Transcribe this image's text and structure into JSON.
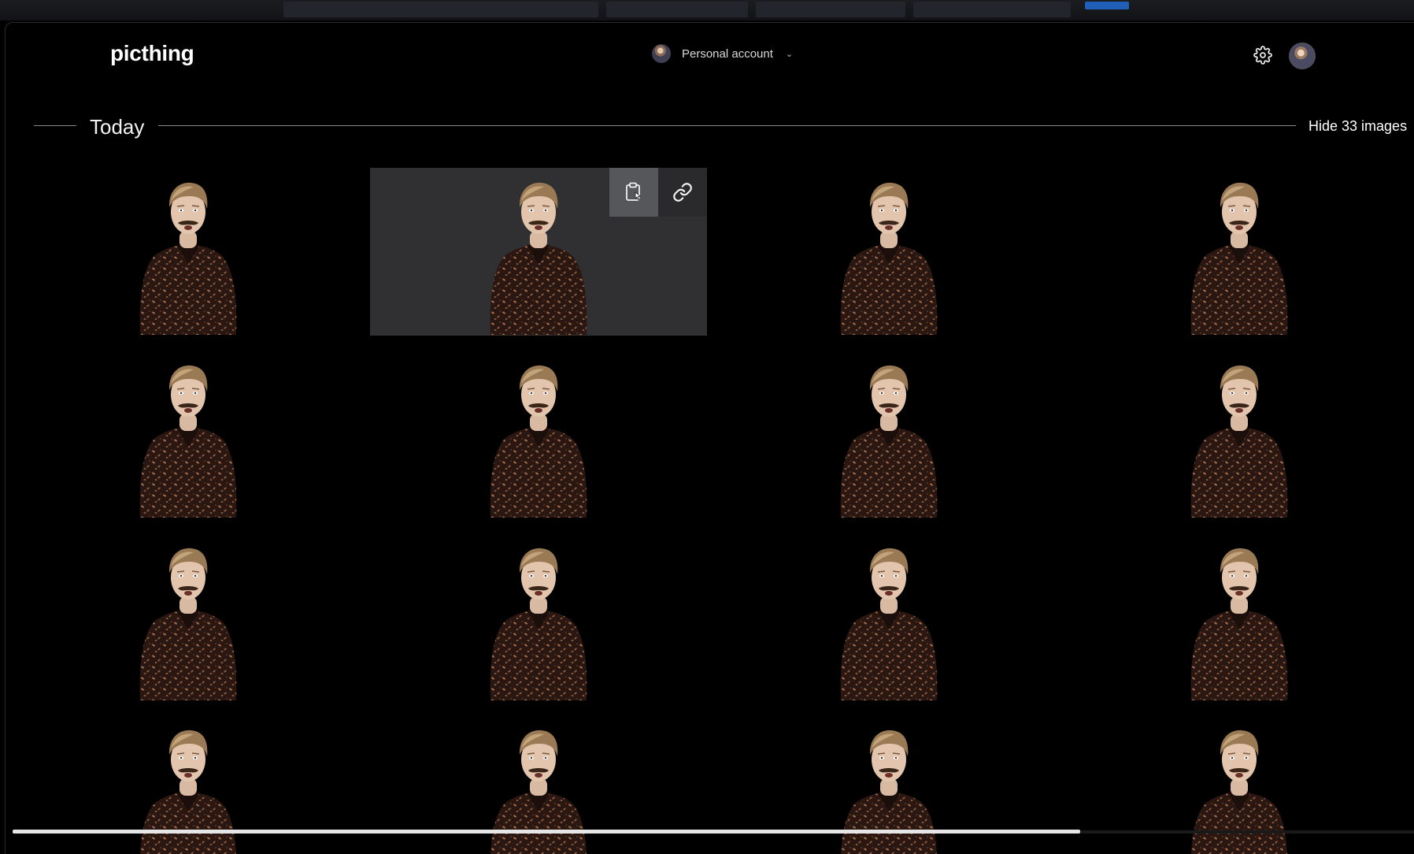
{
  "app": {
    "logo": "picthing",
    "account_label": "Personal account"
  },
  "section": {
    "title": "Today",
    "hide_label": "Hide 33 images"
  },
  "tile_actions": {
    "copy_icon": "clipboard-icon",
    "link_icon": "link-icon"
  },
  "grid": {
    "columns": 4,
    "visible_rows": 4,
    "hovered_tile": 1
  },
  "colors": {
    "background": "#000000",
    "tile_hover": "#303032",
    "copy_button_active": "#56575a",
    "shirt": "#2b1712"
  }
}
